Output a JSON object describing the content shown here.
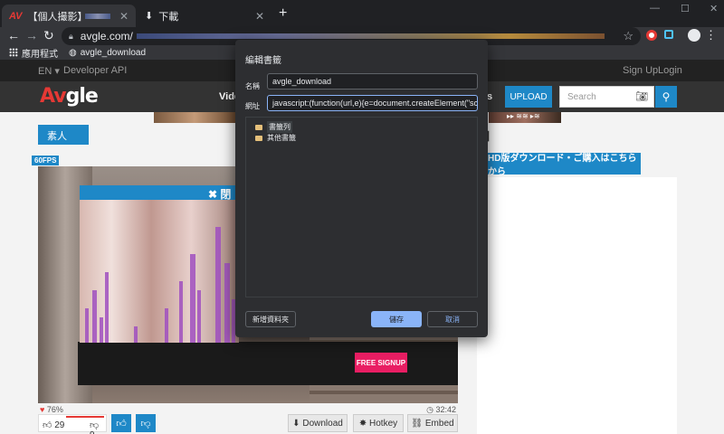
{
  "browser": {
    "tabs": [
      {
        "title": "【個人撮影】",
        "active": true
      },
      {
        "title": "下載",
        "active": false
      }
    ],
    "new_tab": "+",
    "window_controls": {
      "minimize": "—",
      "maximize": "☐",
      "close": "✕"
    },
    "url": "avgle.com/",
    "bookmarks_bar": [
      {
        "label": "應用程式",
        "icon": "apps-icon"
      },
      {
        "label": "avgle_download",
        "icon": "globe-icon"
      }
    ]
  },
  "site": {
    "topbar": {
      "lang": "EN ▾",
      "dev_api": "Developer API",
      "signup": "Sign Up",
      "login": "Login"
    },
    "logo": {
      "a": "Av",
      "rest": "gle"
    },
    "nav_videos": "Vide",
    "nav_partial": "s",
    "upload_label": "UPLOAD",
    "search_placeholder": "Search",
    "banner_text": "▸▸ ≋≋ ▸≋",
    "category_badge": "素人",
    "title_bracket": "】",
    "fps_badge": "60FPS",
    "hd_download": "HD版ダウンロード・ご購入はこちらから",
    "overlay_close": "✖ 閉",
    "free_signup": "FREE SIGNUP",
    "rating_percent": "76%",
    "duration": "32:42",
    "likes": "29",
    "dislikes": "9",
    "actions": {
      "download": "Download",
      "hotkey": "Hotkey",
      "embed": "Embed"
    }
  },
  "dialog": {
    "title": "編輯書籤",
    "name_label": "名稱",
    "name_value": "avgle_download",
    "url_label": "網址",
    "url_value": "javascript:(function(url,e){e=document.createElement(\"script\");e.",
    "folders": [
      {
        "label": "書籤列",
        "selected": true
      },
      {
        "label": "其他書籤",
        "selected": false
      }
    ],
    "new_folder": "新增資料夾",
    "save": "儲存",
    "cancel": "取消"
  },
  "colors": {
    "accent": "#1e88c7",
    "dialog_bg": "#2d2e31",
    "dialog_primary": "#8ab4f8",
    "signup": "#e91e63"
  }
}
